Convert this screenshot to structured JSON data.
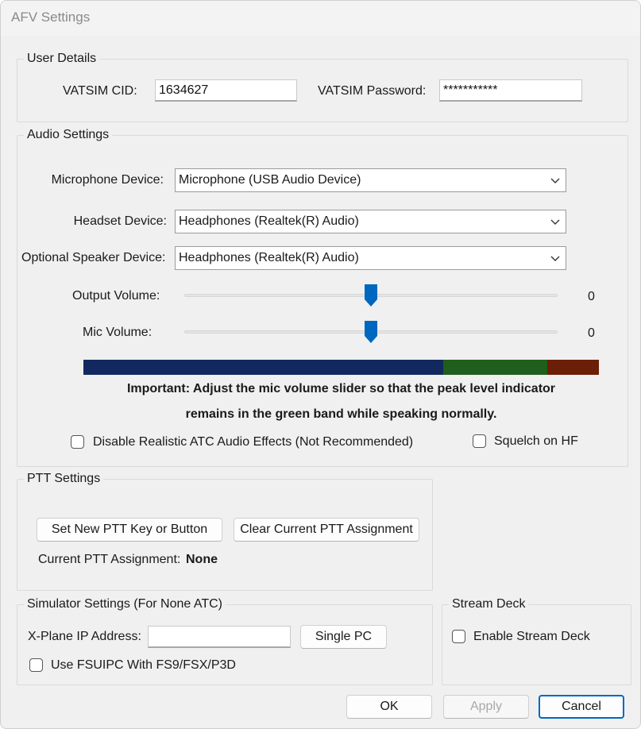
{
  "window": {
    "title": "AFV Settings"
  },
  "user_details": {
    "label": "User Details",
    "cid_label": "VATSIM CID:",
    "cid_value": "1634627",
    "password_label": "VATSIM Password:",
    "password_value": "***********"
  },
  "audio": {
    "label": "Audio Settings",
    "mic_label": "Microphone Device:",
    "mic_value": "Microphone (USB Audio Device)",
    "headset_label": "Headset Device:",
    "headset_value": "Headphones (Realtek(R) Audio)",
    "speaker_label": "Optional Speaker Device:",
    "speaker_value": "Headphones (Realtek(R) Audio)",
    "output_volume_label": "Output Volume:",
    "output_volume_value": "0",
    "output_volume_level": 0.5,
    "mic_volume_label": "Mic Volume:",
    "mic_volume_value": "0",
    "mic_volume_level": 0.5,
    "meter_colors": {
      "low": "#12295f",
      "ok": "#1f5e1c",
      "peak": "#6b1f06"
    },
    "note_line1": "Important: Adjust the mic volume slider so that the peak level indicator",
    "note_line2": "remains in the green band while speaking normally.",
    "disable_effects_label": "Disable Realistic ATC Audio Effects (Not Recommended)",
    "squelch_label": "Squelch on HF"
  },
  "ptt": {
    "label": "PTT Settings",
    "set_button": "Set New PTT Key or Button",
    "clear_button": "Clear Current PTT Assignment",
    "current_label": "Current PTT Assignment:",
    "current_value": "None"
  },
  "simulator": {
    "label": "Simulator Settings (For None ATC)",
    "xplane_label": "X-Plane IP Address:",
    "xplane_value": "",
    "single_pc_button": "Single PC",
    "fsuipc_label": "Use FSUIPC With FS9/FSX/P3D"
  },
  "stream_deck": {
    "label": "Stream Deck",
    "enable_label": "Enable Stream Deck"
  },
  "footer": {
    "ok": "OK",
    "apply": "Apply",
    "cancel": "Cancel"
  },
  "colors": {
    "accent": "#0067c0"
  }
}
